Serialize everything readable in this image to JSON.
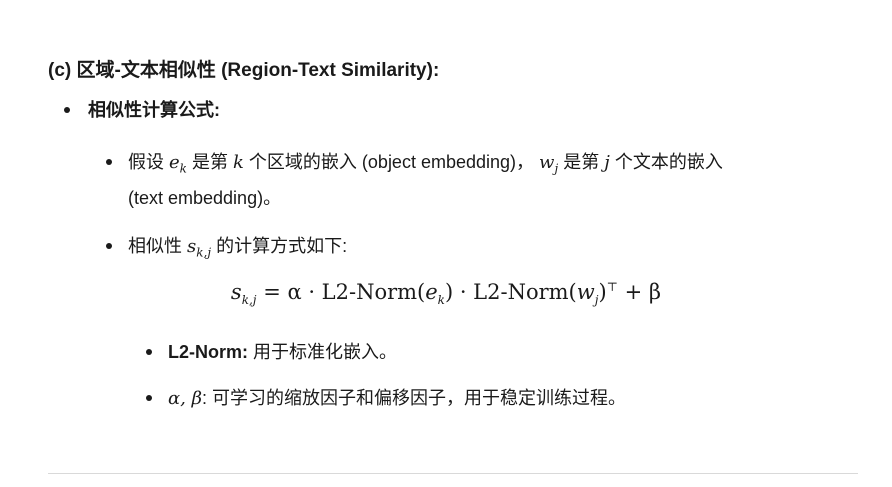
{
  "heading": "(c) 区域-文本相似性 (Region-Text Similarity):",
  "section": {
    "title": "相似性计算公式:"
  },
  "item1": {
    "t1": "假设",
    "e": "e",
    "k_sub": "k",
    "t2": "是第",
    "k": "k",
    "t3": "个区域的嵌入 (object embedding)，",
    "w": "w",
    "j_sub": "j",
    "t4": "是第",
    "j": "j",
    "t5": "个文本的嵌入",
    "line2": "(text embedding)。"
  },
  "item2": {
    "t1": "相似性",
    "s": "s",
    "sub": "k,j",
    "t2": "的计算方式如下:"
  },
  "formula": {
    "lhs": "s",
    "lhs_sub": "k,j",
    "part1": "= α · L2-Norm(",
    "e": "e",
    "e_sub": "k",
    "part2": ") · L2-Norm(",
    "w": "w",
    "w_sub": "j",
    "part3": ")",
    "sup": "⊤",
    "part4": "+ β"
  },
  "sub1": {
    "term": "L2-Norm:",
    "desc": "用于标准化嵌入。"
  },
  "sub2": {
    "term": "α, β",
    "desc": ": 可学习的缩放因子和偏移因子，用于稳定训练过程。"
  }
}
